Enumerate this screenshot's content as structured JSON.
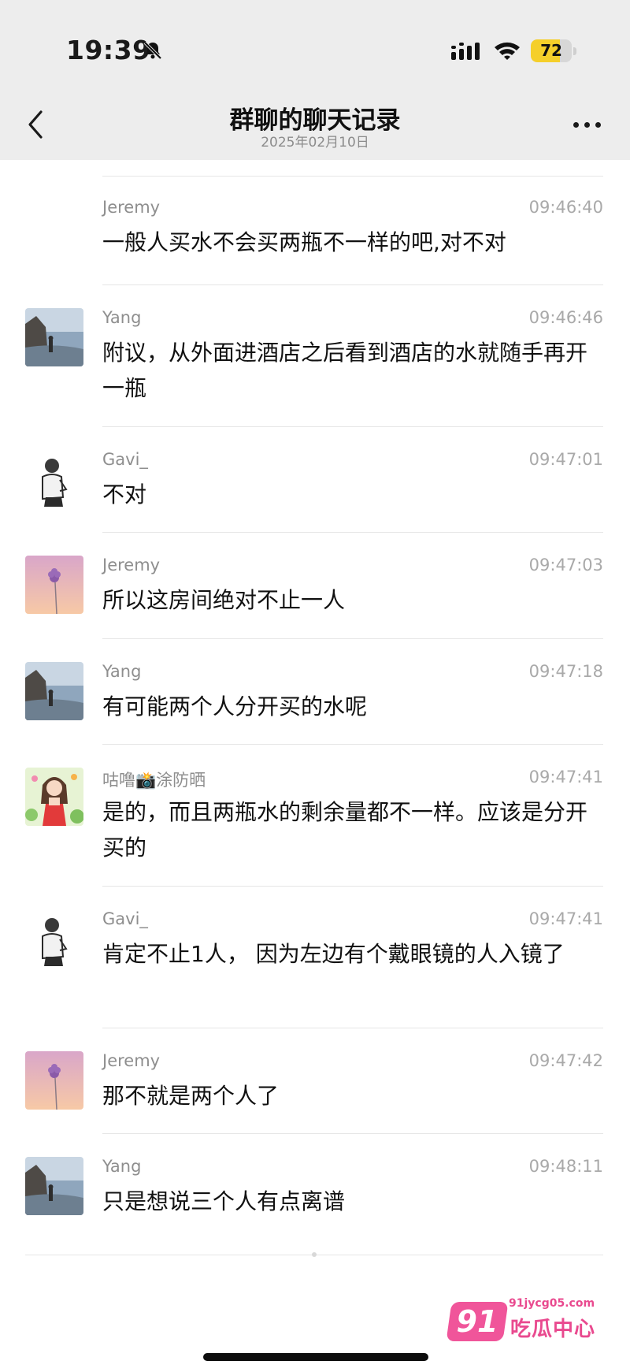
{
  "status_bar": {
    "time": "19:39",
    "battery": "72",
    "battery_level": 0.72,
    "icons": [
      "bell-slash-icon",
      "cellular-signal-icon",
      "wifi-icon",
      "battery-icon"
    ]
  },
  "nav": {
    "title": "群聊的聊天记录",
    "subtitle": "2025年02月10日",
    "icons": [
      "chevron-left-icon",
      "more-icon"
    ]
  },
  "messages": [
    {
      "name": "Jeremy",
      "time": "09:46:40",
      "text": "一般人买水不会买两瓶不一样的吧,对不对",
      "avatar": "none"
    },
    {
      "name": "Yang",
      "time": "09:46:46",
      "text": "附议，从外面进酒店之后看到酒店的水就随手再开一瓶",
      "avatar": "seaside-rock-avatar"
    },
    {
      "name": "Gavi_",
      "time": "09:47:01",
      "text": "不对",
      "avatar": "sketch-man-avatar"
    },
    {
      "name": "Jeremy",
      "time": "09:47:03",
      "text": "所以这房间绝对不止一人",
      "avatar": "pink-flower-avatar"
    },
    {
      "name": "Yang",
      "time": "09:47:18",
      "text": "有可能两个人分开买的水呢",
      "avatar": "seaside-rock-avatar"
    },
    {
      "name": "咕噜📸涂防晒",
      "time": "09:47:41",
      "text": "是的，而且两瓶水的剩余量都不一样。应该是分开买的",
      "avatar": "cartoon-girl-avatar"
    },
    {
      "name": "Gavi_",
      "time": "09:47:41",
      "text": "肯定不止1人， 因为左边有个戴眼镜的人入镜了",
      "avatar": "sketch-man-avatar"
    },
    {
      "name": "Jeremy",
      "time": "09:47:42",
      "text": "那不就是两个人了",
      "avatar": "pink-flower-avatar"
    },
    {
      "name": "Yang",
      "time": "09:48:11",
      "text": "只是想说三个人有点离谱",
      "avatar": "seaside-rock-avatar"
    }
  ],
  "watermark": {
    "badge": "91",
    "url": "91jycg05.com",
    "brand": "吃瓜中心"
  },
  "colors": {
    "header_bg": "#ededed",
    "battery_fill": "#f5cf2a",
    "watermark_pink": "#f0559a"
  }
}
